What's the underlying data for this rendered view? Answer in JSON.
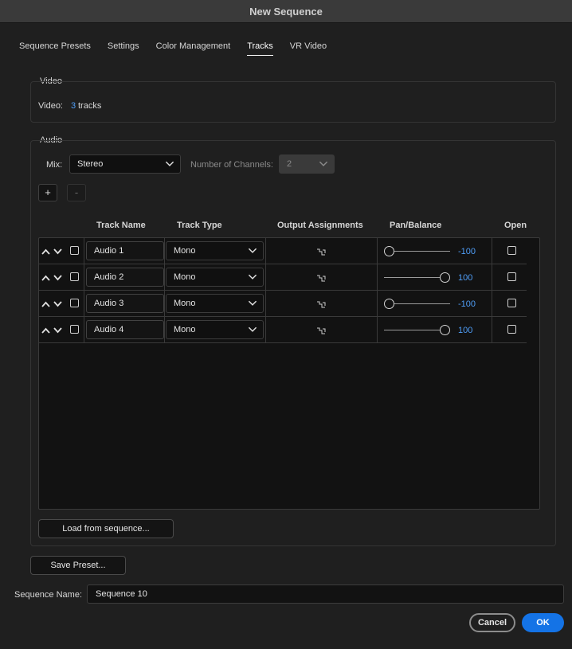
{
  "window": {
    "title": "New Sequence"
  },
  "tabs": [
    {
      "label": "Sequence Presets",
      "active": false
    },
    {
      "label": "Settings",
      "active": false
    },
    {
      "label": "Color Management",
      "active": false
    },
    {
      "label": "Tracks",
      "active": true
    },
    {
      "label": "VR Video",
      "active": false
    }
  ],
  "video": {
    "group_label": "Video",
    "label": "Video:",
    "count": "3",
    "unit": "tracks"
  },
  "audio": {
    "group_label": "Audio",
    "mix_label": "Mix:",
    "mix_value": "Stereo",
    "channels_label": "Number of Channels:",
    "channels_value": "2",
    "add_label": "+",
    "remove_label": "-",
    "headers": {
      "track_name": "Track Name",
      "track_type": "Track Type",
      "output": "Output Assignments",
      "pan": "Pan/Balance",
      "open": "Open"
    },
    "tracks": [
      {
        "name": "Audio 1",
        "type": "Mono",
        "pan": "-100"
      },
      {
        "name": "Audio 2",
        "type": "Mono",
        "pan": "100"
      },
      {
        "name": "Audio 3",
        "type": "Mono",
        "pan": "-100"
      },
      {
        "name": "Audio 4",
        "type": "Mono",
        "pan": "100"
      }
    ],
    "load_button": "Load from sequence..."
  },
  "save_preset_button": "Save Preset...",
  "sequence_name": {
    "label": "Sequence Name:",
    "value": "Sequence 10"
  },
  "cancel_button": "Cancel",
  "ok_button": "OK",
  "colors": {
    "accent": "#1473e6",
    "link": "#4f9ef8"
  }
}
